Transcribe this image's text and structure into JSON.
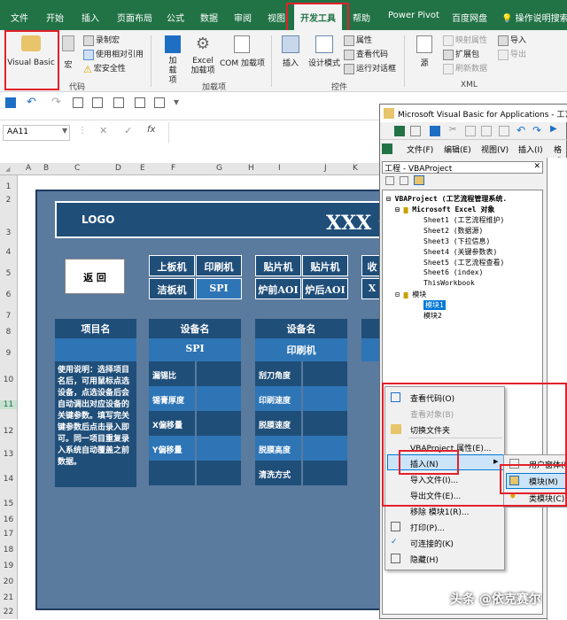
{
  "ribbon_tabs": [
    "文件",
    "开始",
    "插入",
    "页面布局",
    "公式",
    "数据",
    "审阅",
    "视图",
    "开发工具",
    "帮助",
    "Power Pivot",
    "百度网盘"
  ],
  "tell_me": "操作说明搜索",
  "code_group": {
    "vb": "Visual Basic",
    "macro": "宏",
    "record": "录制宏",
    "relative": "使用相对引用",
    "security": "宏安全性",
    "label": "代码"
  },
  "addins_group": {
    "addins": "加载项",
    "excel_addins": "Excel 加载项",
    "com_addins": "COM 加载项",
    "label": "加载项"
  },
  "controls_group": {
    "insert": "插入",
    "design": "设计模式",
    "props": "属性",
    "view_code": "查看代码",
    "run_dialog": "运行对话框",
    "label": "控件"
  },
  "xml_group": {
    "source": "源",
    "map_props": "映射属性",
    "ext_pack": "扩展包",
    "refresh": "刷新数据",
    "import": "导入",
    "export": "导出",
    "label": "XML"
  },
  "namebox": "AA11",
  "fx": "fx",
  "columns": [
    "A",
    "B",
    "C",
    "D",
    "E",
    "F",
    "G",
    "H",
    "I",
    "J",
    "K"
  ],
  "rows": [
    "1",
    "2",
    "3",
    "4",
    "5",
    "6",
    "7",
    "8",
    "9",
    "10",
    "11",
    "12",
    "13",
    "14",
    "15",
    "16",
    "17",
    "18",
    "19",
    "20",
    "21",
    "22"
  ],
  "banner": {
    "logo": "LOGO",
    "title": "XXX 公"
  },
  "back_label": "返 回",
  "nav": [
    [
      "上板机",
      "印刷机",
      "贴片机",
      "贴片机"
    ],
    [
      "洁板机",
      "SPI",
      "炉前AOI",
      "炉后AOI"
    ]
  ],
  "nav_extra": [
    "收",
    "X"
  ],
  "table": {
    "col1_head": "项目名",
    "col2_head": "设备名",
    "col2_sub": "SPI",
    "col3_head": "设备名",
    "col3_sub": "印刷机",
    "instructions": "使用说明：选择项目名后，可用鼠标点选设备，点选设备后会自动调出对应设备的关键参数。填写完关键参数后点击录入即可。同一项目重复录入系统自动覆盖之前数据。",
    "spi_params": [
      "漏锡比",
      "锡膏厚度",
      "X偏移量",
      "Y偏移量",
      ""
    ],
    "print_params": [
      "刮刀角度",
      "印刷速度",
      "脱膜速度",
      "脱膜高度",
      "清洗方式"
    ]
  },
  "vbe": {
    "title": "Microsoft Visual Basic for Applications - 工艺",
    "menu": [
      "文件(F)",
      "编辑(E)",
      "视图(V)",
      "插入(I)",
      "格式"
    ],
    "project_title": "工程 - VBAProject",
    "tree": [
      "VBAProject (工艺流程管理系统.",
      "Microsoft Excel 对象",
      "Sheet1 (工艺流程维护)",
      "Sheet2 (数据源)",
      "Sheet3 (下拉信息)",
      "Sheet4 (关键参数表)",
      "Sheet5 (工艺流程查看)",
      "Sheet6 (index)",
      "ThisWorkbook",
      "模块",
      "模块1",
      "模块2"
    ]
  },
  "context_menu": [
    "查看代码(O)",
    "查看对象(B)",
    "切换文件夹",
    "VBAProject 属性(E)...",
    "插入(N)",
    "导入文件(I)...",
    "导出文件(E)...",
    "移除 模块1(R)...",
    "打印(P)...",
    "可连接的(K)",
    "隐藏(H)"
  ],
  "submenu": [
    "用户窗体(U)",
    "模块(M)",
    "类模块(C)"
  ],
  "watermark": "头条 @依克赛尔"
}
